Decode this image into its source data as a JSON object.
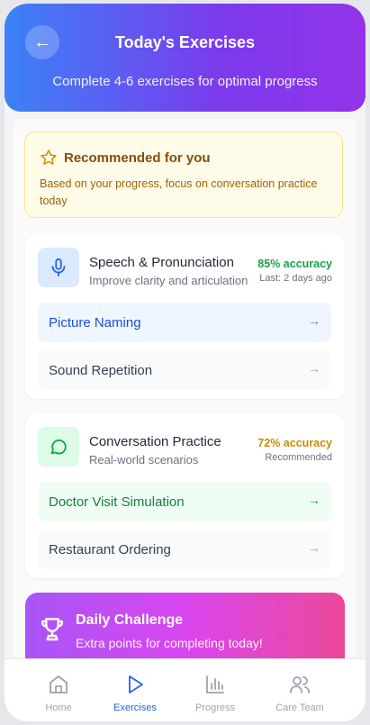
{
  "header": {
    "title": "Today's Exercises",
    "subtitle": "Complete 4-6 exercises for optimal progress",
    "back_icon": "arrow-left-icon"
  },
  "recommendation": {
    "icon": "star-icon",
    "title": "Recommended for you",
    "body": "Based on your progress, focus on conversation practice today"
  },
  "categories": [
    {
      "icon": "microphone-icon",
      "title": "Speech & Pronunciation",
      "subtitle": "Improve clarity and articulation",
      "accuracy": "85% accuracy",
      "meta": "Last: 2 days ago",
      "accent": "#16a34a",
      "exercises": [
        {
          "label": "Picture Naming",
          "highlighted": true
        },
        {
          "label": "Sound Repetition",
          "highlighted": false
        }
      ]
    },
    {
      "icon": "chat-bubble-icon",
      "title": "Conversation Practice",
      "subtitle": "Real-world scenarios",
      "accuracy": "72% accuracy",
      "meta": "Recommended",
      "accent": "#ca8a04",
      "exercises": [
        {
          "label": "Doctor Visit Simulation",
          "highlighted": true
        },
        {
          "label": "Restaurant Ordering",
          "highlighted": false
        }
      ]
    }
  ],
  "challenge": {
    "icon": "trophy-icon",
    "title": "Daily Challenge",
    "subtitle": "Extra points for completing today!"
  },
  "nav": {
    "items": [
      {
        "label": "Home",
        "icon": "home-icon",
        "active": false
      },
      {
        "label": "Exercises",
        "icon": "play-icon",
        "active": true
      },
      {
        "label": "Progress",
        "icon": "bar-chart-icon",
        "active": false
      },
      {
        "label": "Care Team",
        "icon": "users-icon",
        "active": false
      }
    ]
  },
  "colors": {
    "primary": "#2563eb",
    "header_gradient_start": "#3b82f6",
    "header_gradient_end": "#9333ea",
    "success": "#16a34a",
    "warning": "#ca8a04",
    "challenge_gradient_start": "#a855f7",
    "challenge_gradient_end": "#ec4899"
  }
}
